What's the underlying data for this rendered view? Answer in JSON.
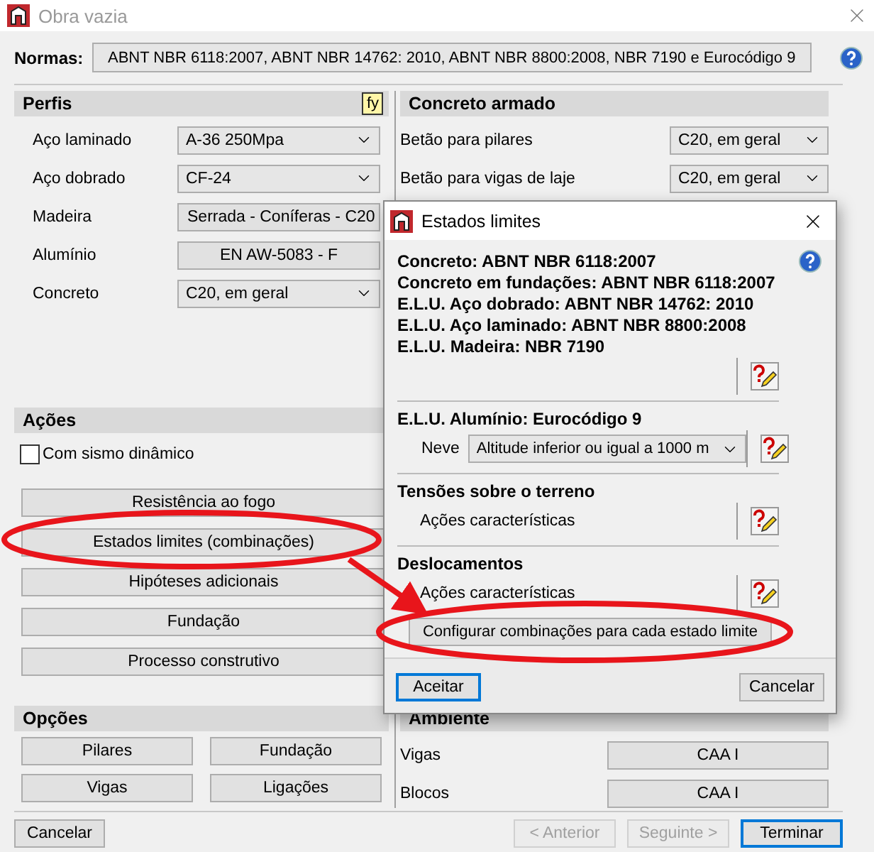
{
  "window": {
    "title": "Obra vazia",
    "active": false
  },
  "normas": {
    "label": "Normas:",
    "value": "ABNT NBR 6118:2007, ABNT NBR 14762: 2010, ABNT NBR 8800:2008, NBR 7190 e Eurocódigo 9"
  },
  "perfis": {
    "title": "Perfis",
    "icon_label": "fy",
    "fields": [
      {
        "label": "Aço laminado",
        "value": "A-36 250Mpa",
        "kind": "select"
      },
      {
        "label": "Aço dobrado",
        "value": "CF-24",
        "kind": "select"
      },
      {
        "label": "Madeira",
        "value": "Serrada - Coníferas - C20",
        "kind": "button"
      },
      {
        "label": "Alumínio",
        "value": "EN AW-5083 - F",
        "kind": "button"
      },
      {
        "label": "Concreto",
        "value": "C20, em geral",
        "kind": "select"
      }
    ]
  },
  "acoes": {
    "title": "Ações",
    "checkbox": {
      "label": "Com sismo dinâmico",
      "checked": false
    },
    "buttons": [
      "Resistência ao fogo",
      "Estados limites (combinações)",
      "Hipóteses adicionais",
      "Fundação",
      "Processo construtivo"
    ]
  },
  "concreto": {
    "title": "Concreto armado",
    "fields": [
      {
        "label": "Betão para pilares",
        "value": "C20, em geral",
        "kind": "select"
      },
      {
        "label": "Betão para vigas de laje",
        "value": "C20, em geral",
        "kind": "select"
      }
    ]
  },
  "opcoes": {
    "title": "Opções",
    "buttons": [
      "Pilares",
      "Fundação",
      "Vigas",
      "Ligações"
    ]
  },
  "ambiente": {
    "title": "Ambiente",
    "fields": [
      {
        "label": "Vigas",
        "value": "CAA I",
        "kind": "button"
      },
      {
        "label": "Blocos",
        "value": "CAA I",
        "kind": "button"
      }
    ]
  },
  "footer": {
    "buttons": [
      {
        "label": "Cancelar",
        "disabled": false,
        "default": false
      },
      {
        "label": "< Anterior",
        "disabled": true,
        "default": false
      },
      {
        "label": "Seguinte >",
        "disabled": true,
        "default": false
      },
      {
        "label": "Terminar",
        "disabled": false,
        "default": true
      }
    ]
  },
  "dialog": {
    "title": "Estados limites",
    "sections": [
      {
        "kind": "lines",
        "lines": [
          "Concreto: ABNT NBR 6118:2007",
          "Concreto em fundações: ABNT NBR 6118:2007",
          "E.L.U. Aço dobrado: ABNT NBR 14762: 2010",
          "E.L.U. Aço laminado: ABNT NBR 8800:2008",
          "E.L.U. Madeira: NBR 7190"
        ]
      },
      {
        "kind": "select",
        "title": "E.L.U. Alumínio: Eurocódigo 9",
        "label": "Neve",
        "value": "Altitude inferior ou igual a 1000 m"
      },
      {
        "kind": "text",
        "title": "Tensões sobre o terreno",
        "text": "Ações características"
      },
      {
        "kind": "text",
        "title": "Deslocamentos",
        "text": "Ações características"
      }
    ],
    "configure": "Configurar combinações para cada estado limite",
    "buttons": [
      {
        "label": "Aceitar",
        "default": true
      },
      {
        "label": "Cancelar",
        "default": false
      }
    ]
  }
}
